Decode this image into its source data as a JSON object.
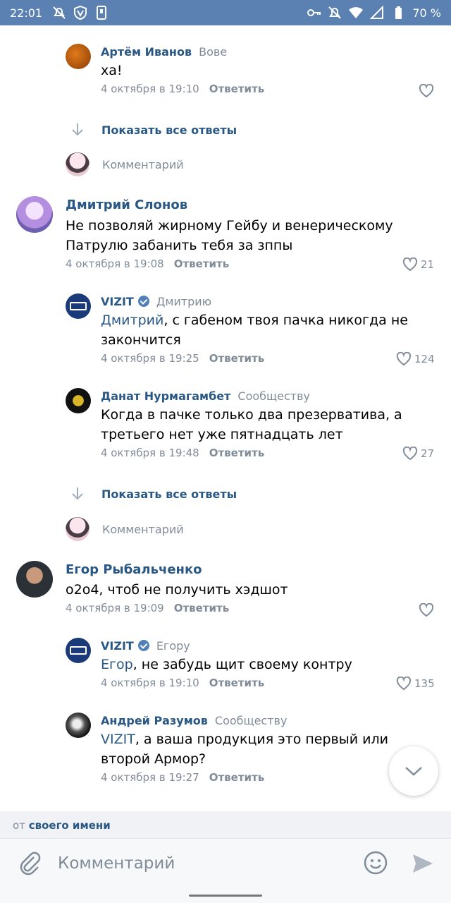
{
  "status_bar": {
    "time": "22:01",
    "battery": "70 %"
  },
  "colors": {
    "accent": "#2a5885",
    "header": "#5a81b2",
    "muted": "#818c99"
  },
  "comments": [
    {
      "author": "Артём Иванов",
      "reply_to": "Вове",
      "text": "ха!",
      "date": "4 октября в 19:10",
      "reply_label": "Ответить",
      "likes": ""
    },
    {
      "author": "Дмитрий Слонов",
      "reply_to": "",
      "text": "Не позволяй жирному Гейбу и венерическому Патрулю забанить тебя за зппы",
      "date": "4 октября в 19:08",
      "reply_label": "Ответить",
      "likes": "21"
    },
    {
      "author": "VIZIT",
      "reply_to": "Дмитрию",
      "mention": "Дмитрий",
      "text": ", с габеном твоя пачка никогда не закончится",
      "date": "4 октября в 19:25",
      "reply_label": "Ответить",
      "likes": "124"
    },
    {
      "author": "Данат Нурмагамбет",
      "reply_to": "Сообществу",
      "text": "Когда в пачке только два презерватива, а третьего нет уже пятнадцать лет",
      "date": "4 октября в 19:48",
      "reply_label": "Ответить",
      "likes": "27"
    },
    {
      "author": "Егор Рыбальченко",
      "reply_to": "",
      "text": "о2о4, чтоб не получить хэдшот",
      "date": "4 октября в 19:09",
      "reply_label": "Ответить",
      "likes": ""
    },
    {
      "author": "VIZIT",
      "reply_to": "Егору",
      "mention": "Егор",
      "text": ", не забудь щит своему контру",
      "date": "4 октября в 19:10",
      "reply_label": "Ответить",
      "likes": "135"
    },
    {
      "author": "Андрей Разумов",
      "reply_to": "Сообществу",
      "mention": "VIZIT",
      "text": ", а ваша продукция это первый или второй Армор?",
      "date": "4 октября в 19:27",
      "reply_label": "Ответить",
      "likes": ""
    }
  ],
  "show_replies_label": "Показать все ответы",
  "comment_placeholder": "Комментарий",
  "from_bar": {
    "prefix": "от",
    "link": "своего имени"
  },
  "composer": {
    "placeholder": "Комментарий"
  }
}
